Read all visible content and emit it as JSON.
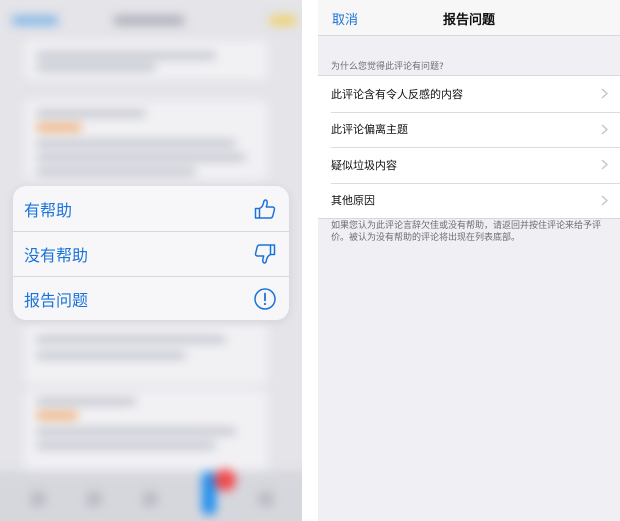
{
  "context_menu": {
    "items": [
      {
        "label": "有帮助",
        "icon": "thumbs-up-icon"
      },
      {
        "label": "没有帮助",
        "icon": "thumbs-down-icon"
      },
      {
        "label": "报告问题",
        "icon": "exclamation-circle-icon"
      }
    ]
  },
  "report_sheet": {
    "nav": {
      "cancel_label": "取消",
      "title": "报告问题"
    },
    "section_header": "为什么您觉得此评论有问题?",
    "reasons": [
      {
        "label": "此评论含有令人反感的内容"
      },
      {
        "label": "此评论偏离主题"
      },
      {
        "label": "疑似垃圾内容"
      },
      {
        "label": "其他原因"
      }
    ],
    "footer_note": "如果您认为此评论言辞欠佳或没有帮助，请返回并按住评论来给予评价。被认为没有帮助的评论将出现在列表底部。"
  },
  "colors": {
    "accent": "#1a73d9",
    "menu_background": "#f7f7fa",
    "grouped_background": "#efeff4"
  }
}
